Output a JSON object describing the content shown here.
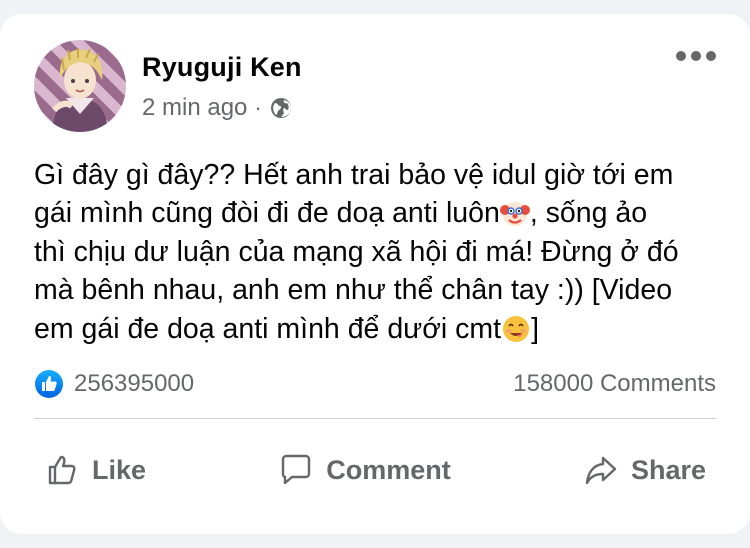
{
  "post": {
    "author": "Ryuguji Ken",
    "time": "2 min ago",
    "separator": "·",
    "privacy_icon": "globe-icon",
    "more_icon": "more-horizontal-icon",
    "text_part1": "Gì đây gì đây?? Hết anh trai bảo vệ idul giờ tới em\ngái mình cũng đòi đi đe doạ anti luôn",
    "emoji1": "clown-face-emoji",
    "text_part2": ", sống ảo\nthì chịu dư luận của mạng xã hội đi má! Đừng ở đó\nmà bênh nhau, anh em như thể chân tay :)) [Video\nem gái đe doạ anti mình để dưới cmt",
    "emoji2": "smiling-face-emoji",
    "text_part3": "]"
  },
  "stats": {
    "like_icon": "like-badge-icon",
    "like_count": "256395000",
    "comment_count": "158000 Comments"
  },
  "actions": {
    "like_label": "Like",
    "comment_label": "Comment",
    "share_label": "Share"
  },
  "colors": {
    "background": "#f0f2f5",
    "card": "#ffffff",
    "text": "#050505",
    "secondary": "#65676b",
    "like_blue": "#1877f2",
    "divider": "#ced0d4"
  }
}
